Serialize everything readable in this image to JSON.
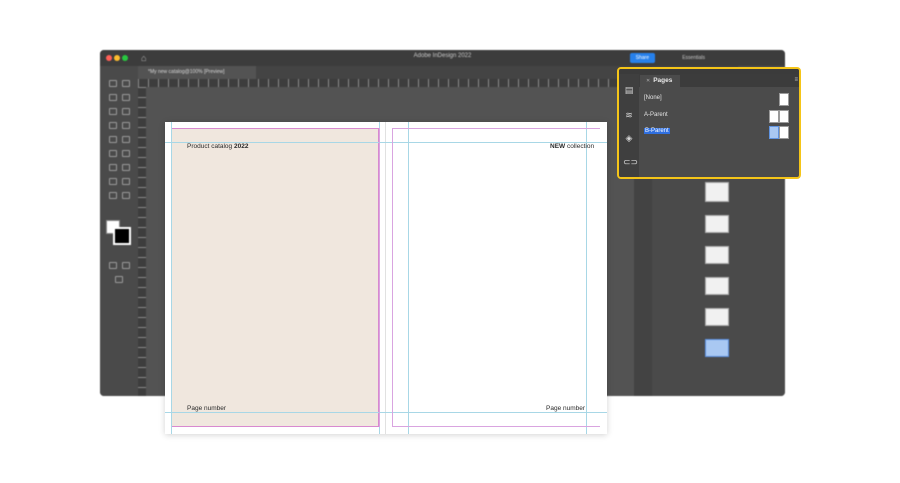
{
  "app": {
    "title": "Adobe InDesign 2022",
    "share_label": "Share",
    "workspace_label": "Essentials",
    "document_tab": "*My new catalog@100% [Preview]"
  },
  "spread": {
    "header_left_prefix": "Product catalog ",
    "header_left_bold": "2022",
    "header_right_bold": "NEW",
    "header_right_rest": " collection",
    "footer_left": "Page number",
    "footer_right": "Page number"
  },
  "pages_panel": {
    "title": "Pages",
    "menu_icon": "hamburger-menu-icon",
    "rows": [
      {
        "label": "[None]"
      },
      {
        "label": "A-Parent"
      },
      {
        "label": "B-Parent"
      }
    ],
    "side_icons": [
      "pages-icon",
      "layers-stack-icon",
      "layers-icon",
      "links-icon"
    ]
  },
  "colors": {
    "highlight": "#f5c518",
    "selection": "#2f6fe0",
    "left_page_fill": "#f0e7de"
  }
}
